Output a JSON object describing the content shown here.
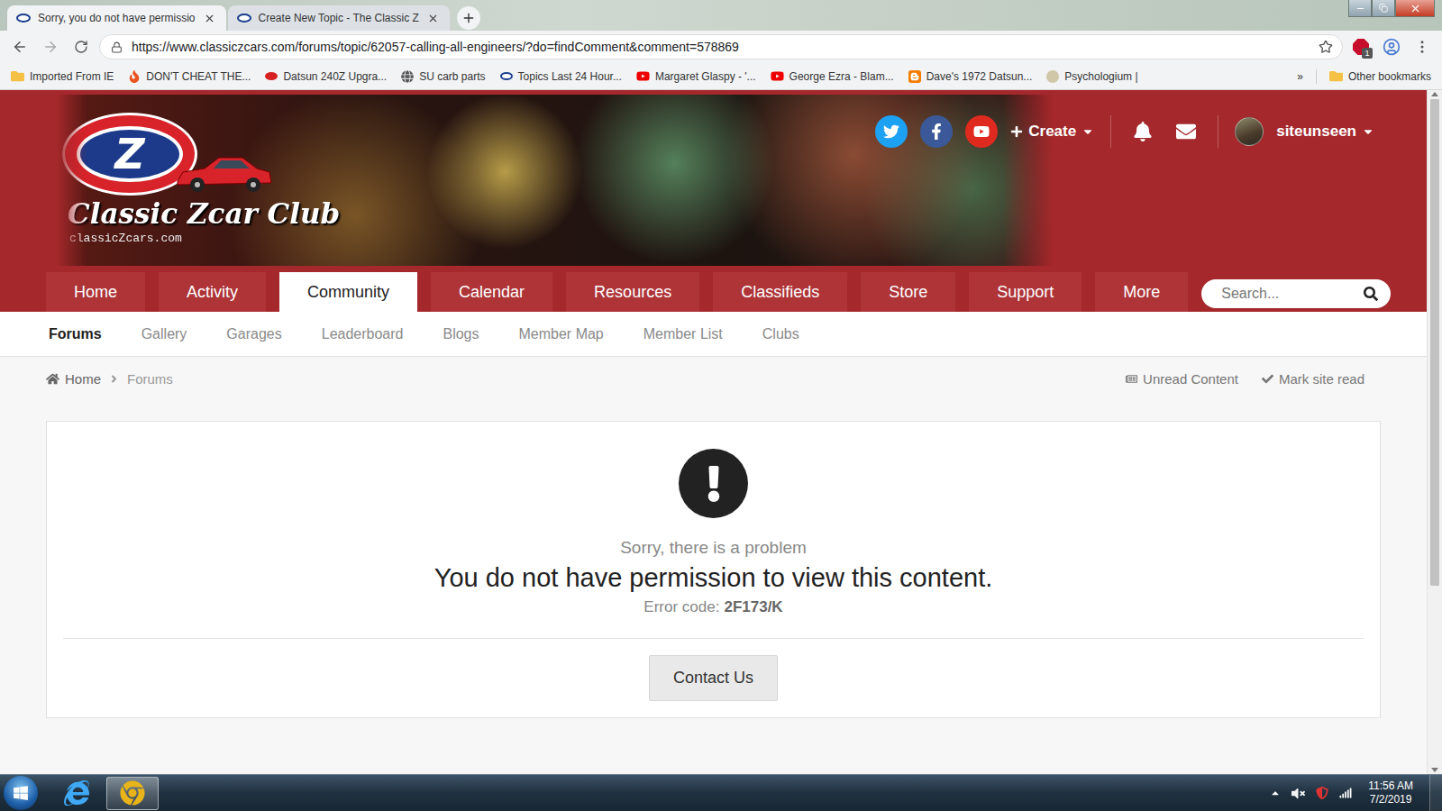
{
  "browser": {
    "tabs": [
      {
        "title": "Sorry, you do not have permissio",
        "selected": true
      },
      {
        "title": "Create New Topic - The Classic Z",
        "selected": false
      }
    ],
    "url": "https://www.classiczcars.com/forums/topic/62057-calling-all-engineers/?do=findComment&comment=578869",
    "extension_badge": "1",
    "bookmarks": [
      {
        "label": "Imported From IE",
        "kind": "folder"
      },
      {
        "label": "DON'T CHEAT THE...",
        "kind": "fire"
      },
      {
        "label": "Datsun 240Z Upgra...",
        "kind": "z"
      },
      {
        "label": "SU carb parts",
        "kind": "globe"
      },
      {
        "label": "Topics Last 24 Hour...",
        "kind": "oval"
      },
      {
        "label": "Margaret Glaspy - '...",
        "kind": "youtube"
      },
      {
        "label": "George Ezra - Blam...",
        "kind": "youtube"
      },
      {
        "label": "Dave's 1972 Datsun...",
        "kind": "blogger"
      },
      {
        "label": "Psychologium |",
        "kind": "site"
      }
    ],
    "bookmarks_overflow": "»",
    "other_bookmarks": "Other bookmarks"
  },
  "site": {
    "logo": {
      "emblem": "Z",
      "title": "Classic Zcar Club",
      "domain": "classicZcars.com"
    },
    "user_bar": {
      "create": "Create",
      "username": "siteunseen"
    },
    "nav": [
      {
        "label": "Home",
        "selected": false
      },
      {
        "label": "Activity",
        "selected": false
      },
      {
        "label": "Community",
        "selected": true
      },
      {
        "label": "Calendar",
        "selected": false
      },
      {
        "label": "Resources",
        "selected": false
      },
      {
        "label": "Classifieds",
        "selected": false
      },
      {
        "label": "Store",
        "selected": false
      },
      {
        "label": "Support",
        "selected": false
      },
      {
        "label": "More",
        "selected": false
      }
    ],
    "search": {
      "placeholder": "Search..."
    },
    "subnav": [
      {
        "label": "Forums",
        "selected": true
      },
      {
        "label": "Gallery",
        "selected": false
      },
      {
        "label": "Garages",
        "selected": false
      },
      {
        "label": "Leaderboard",
        "selected": false
      },
      {
        "label": "Blogs",
        "selected": false
      },
      {
        "label": "Member Map",
        "selected": false
      },
      {
        "label": "Member List",
        "selected": false
      },
      {
        "label": "Clubs",
        "selected": false
      }
    ],
    "breadcrumbs": [
      "Home",
      "Forums"
    ],
    "page_actions": [
      "Unread Content",
      "Mark site read"
    ]
  },
  "error": {
    "heading": "Sorry, there is a problem",
    "message": "You do not have permission to view this content.",
    "code_label": "Error code:",
    "code": "2F173/K",
    "button": "Contact Us"
  },
  "taskbar": {
    "apps": [
      {
        "name": "ie",
        "selected": false
      },
      {
        "name": "chrome",
        "selected": true
      }
    ],
    "time": "11:56 AM",
    "date": "7/2/2019"
  }
}
